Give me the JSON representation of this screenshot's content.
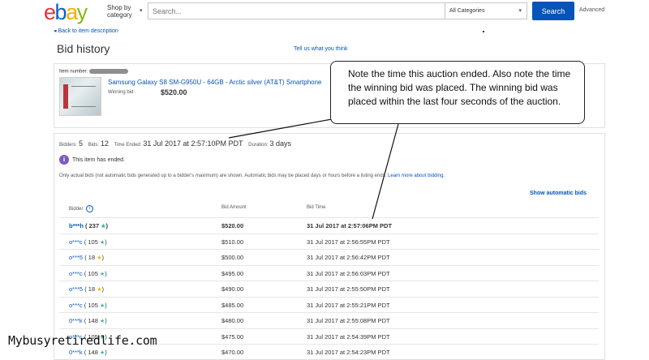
{
  "header": {
    "logo": {
      "e": "e",
      "b": "b",
      "a": "a",
      "y": "y"
    },
    "shop_by": "Shop by",
    "category": "category",
    "search_placeholder": "Search...",
    "category_select": "All Categories",
    "search_button": "Search",
    "advanced": "Advanced"
  },
  "nav": {
    "back_link": "◂ Back to item description",
    "page_title": "Bid history",
    "tell_us": "Tell us what you think"
  },
  "item": {
    "number_label": "Item number:",
    "title": "Samsung Galaxy S8 SM-G950U - 64GB - Arctic silver (AT&T) Smartphone",
    "winning_bid_label": "Winning bid:",
    "winning_bid_value": "$520.00"
  },
  "callout": {
    "text": "Note the time this auction ended. Also note the time the winning bid was placed. The winning bid was placed within the last four seconds of the auction."
  },
  "summary": {
    "bidders_label": "Bidders:",
    "bidders_value": "5",
    "bids_label": "Bids:",
    "bids_value": "12",
    "time_ended_label": "Time Ended:",
    "time_ended_value": "31 Jul 2017 at 2:57:10PM PDT",
    "duration_label": "Duration:",
    "duration_value": "3 days",
    "ended_message": "This item has ended.",
    "note": "Only actual bids (not automatic bids generated up to a bidder's maximum) are shown. Automatic bids may be placed days or hours before a listing ends.",
    "learn_more": "Learn more about bidding.",
    "show_automatic": "Show automatic bids"
  },
  "table": {
    "headers": {
      "bidder": "Bidder",
      "amount": "Bid Amount",
      "time": "Bid Time"
    },
    "rows": [
      {
        "bidder": "b***h",
        "feedback": "( 237 ★)",
        "star_color": "#3fb4a6",
        "amount": "$520.00",
        "time": "31 Jul 2017 at 2:57:06PM PDT",
        "winner": true
      },
      {
        "bidder": "o***c",
        "feedback": "( 105 ★)",
        "star_color": "#3fb4a6",
        "amount": "$510.00",
        "time": "31 Jul 2017 at 2:56:55PM PDT",
        "winner": false
      },
      {
        "bidder": "o***5",
        "feedback": "( 18 ★)",
        "star_color": "#f0b400",
        "amount": "$500.00",
        "time": "31 Jul 2017 at 2:56:42PM PDT",
        "winner": false
      },
      {
        "bidder": "o***c",
        "feedback": "( 105 ★)",
        "star_color": "#3fb4a6",
        "amount": "$495.00",
        "time": "31 Jul 2017 at 2:56:03PM PDT",
        "winner": false
      },
      {
        "bidder": "o***5",
        "feedback": "( 18 ★)",
        "star_color": "#f0b400",
        "amount": "$490.00",
        "time": "31 Jul 2017 at 2:55:50PM PDT",
        "winner": false
      },
      {
        "bidder": "o***c",
        "feedback": "( 105 ★)",
        "star_color": "#3fb4a6",
        "amount": "$485.00",
        "time": "31 Jul 2017 at 2:55:21PM PDT",
        "winner": false
      },
      {
        "bidder": "0***k",
        "feedback": "( 148 ★)",
        "star_color": "#3fb4a6",
        "amount": "$480.00",
        "time": "31 Jul 2017 at 2:55:08PM PDT",
        "winner": false
      },
      {
        "bidder": "o***c",
        "feedback": "( 105 ★)",
        "star_color": "#3fb4a6",
        "amount": "$475.00",
        "time": "31 Jul 2017 at 2:54:39PM PDT",
        "winner": false
      },
      {
        "bidder": "0***k",
        "feedback": "( 148 ★)",
        "star_color": "#3fb4a6",
        "amount": "$470.00",
        "time": "31 Jul 2017 at 2:54:23PM PDT",
        "winner": false
      }
    ]
  },
  "watermark": "Mybusyretiredlife.com"
}
